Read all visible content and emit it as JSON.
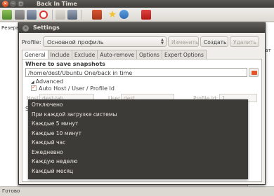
{
  "main_window": {
    "title": "Back In Time",
    "left_pane_label": "Резерв",
    "right_pane_label": "Дат",
    "status_text": "Готово"
  },
  "dialog": {
    "title": "Settings",
    "profile_label": "Profile:",
    "profile_value": "Основной профиль",
    "buttons": {
      "edit": "Изменить",
      "add": "Создать",
      "remove": "Удалить"
    },
    "tabs": [
      {
        "label": "General",
        "active": true
      },
      {
        "label": "Include",
        "active": false
      },
      {
        "label": "Exclude",
        "active": false
      },
      {
        "label": "Auto-remove",
        "active": false
      },
      {
        "label": "Options",
        "active": false
      },
      {
        "label": "Expert Options",
        "active": false
      }
    ],
    "general": {
      "where_to_save_heading": "Where to save snapshots",
      "snapshot_path": "/home/dest/Ubuntu One/back in time",
      "advanced_label": "Advanced",
      "auto_host_label": "Auto Host / User / Profile Id",
      "auto_host_checked": true,
      "host_label": "Host:",
      "host_value": "dest-lab",
      "user_label": "User:",
      "user_value": "dest",
      "profile_id_label": "Profile Id:",
      "profile_id_value": "1",
      "schedule_label_visible": "S"
    }
  },
  "schedule_dropdown": {
    "options": [
      "Отключено",
      "При каждой загрузке системы",
      "Каждые 5 минут",
      "Каждые 10 минут",
      "Каждый час",
      "Ежедневно",
      "Каждую неделю",
      "Каждый месяц"
    ]
  },
  "colors": {
    "titlebar": "#3c3b37",
    "accent": "#e2572a",
    "popup_bg": "#3c3b37"
  }
}
